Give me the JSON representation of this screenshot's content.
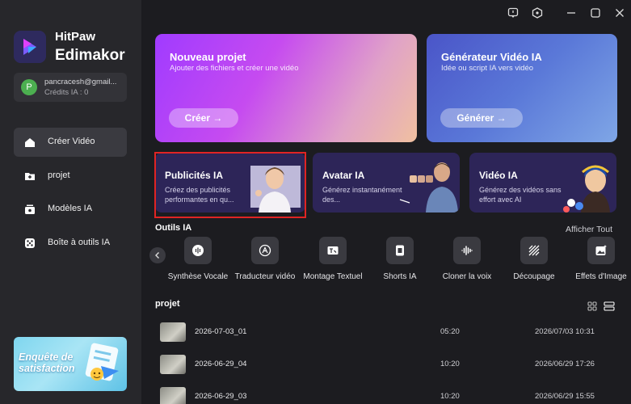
{
  "app": {
    "brand_line1": "HitPaw",
    "brand_line2": "Edimakor"
  },
  "account": {
    "avatar_letter": "P",
    "email": "pancracesh@gmail...",
    "credits": "Crédits IA : 0"
  },
  "sidebar": {
    "items": [
      {
        "label": "Créer Vidéo",
        "icon": "home-icon",
        "active": true
      },
      {
        "label": "projet",
        "icon": "folder-plus-icon",
        "active": false
      },
      {
        "label": "Modèles IA",
        "icon": "template-icon",
        "active": false
      },
      {
        "label": "Boîte à outils IA",
        "icon": "toolbox-icon",
        "active": false
      }
    ]
  },
  "survey": {
    "text": "Enquête de satisfaction"
  },
  "hero": {
    "new_project": {
      "title": "Nouveau projet",
      "subtitle": "Ajouter des fichiers et créer une vidéo",
      "button": "Créer →"
    },
    "generator": {
      "title": "Générateur Vidéo IA",
      "subtitle": "Idée ou script IA vers vidéo",
      "button": "Générer →"
    }
  },
  "features": [
    {
      "title": "Publicités IA",
      "subtitle": "Créez des publicités performantes en qu..."
    },
    {
      "title": "Avatar IA",
      "subtitle": "Générez instantanément des..."
    },
    {
      "title": "Vidéo IA",
      "subtitle": "Générez des vidéos sans effort avec AI"
    }
  ],
  "tools": {
    "heading": "Outils IA",
    "show_all": "Afficher Tout",
    "items": [
      {
        "label": "Synthèse Vocale",
        "icon": "voice-icon"
      },
      {
        "label": "Traducteur vidéo",
        "icon": "translate-icon"
      },
      {
        "label": "Montage Textuel",
        "icon": "text-edit-icon"
      },
      {
        "label": "Shorts IA",
        "icon": "shorts-icon"
      },
      {
        "label": "Cloner la voix",
        "icon": "waveform-icon"
      },
      {
        "label": "Découpage",
        "icon": "cutout-icon"
      },
      {
        "label": "Effets d'Image",
        "icon": "image-effect-icon"
      }
    ]
  },
  "projects": {
    "heading": "projet",
    "rows": [
      {
        "name": "2026-07-03_01",
        "duration": "05:20",
        "date": "2026/07/03 10:31"
      },
      {
        "name": "2026-06-29_04",
        "duration": "10:20",
        "date": "2026/06/29 17:26"
      },
      {
        "name": "2026-06-29_03",
        "duration": "10:20",
        "date": "2026/06/29 15:55"
      }
    ]
  },
  "colors": {
    "highlight": "#e02424",
    "sidebar": "#27272b",
    "background": "#1c1c20"
  }
}
